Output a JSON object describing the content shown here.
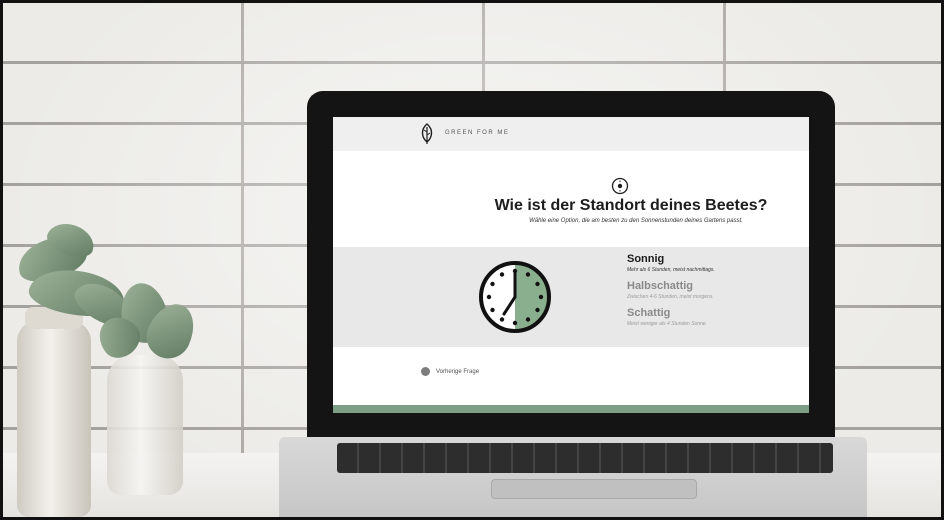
{
  "app": {
    "brand": "GREEN FOR ME"
  },
  "question": {
    "title": "Wie ist der Standort deines Beetes?",
    "subtitle": "Wähle eine Option, die am besten zu den Sonnenstunden deines Gartens passt."
  },
  "options": [
    {
      "label": "Sonnig",
      "description": "Mehr als 6 Stunden, meist nachmittags.",
      "selected": true
    },
    {
      "label": "Halbschattig",
      "description": "Zwischen 4-6 Stunden, meist morgens.",
      "selected": false
    },
    {
      "label": "Schattig",
      "description": "Meist weniger als 4 Stunden Sonne.",
      "selected": false
    }
  ],
  "navigation": {
    "previous_label": "Vorherige Frage"
  },
  "progress": {
    "fraction": 1.0
  },
  "colors": {
    "accent_green": "#7e9e86",
    "clock_green": "#8aaf8f",
    "topbar": "#efefef",
    "band": "#e8e8e8"
  },
  "icons": {
    "logo": "leaf-icon",
    "question": "sun-badge-icon",
    "visual": "clock-icon",
    "previous": "circle-back-icon"
  }
}
